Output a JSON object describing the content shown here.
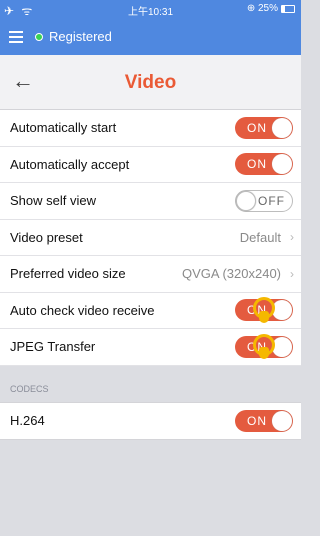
{
  "status_bar": {
    "left": "✈ ᯤ",
    "time": "上午10:31",
    "battery_percent": "⊕ 25%"
  },
  "top_bar": {
    "menu_icon": "hamburger-menu-icon",
    "status": "Registered",
    "status_color": "#39d353",
    "bg_color": "#4f88e0"
  },
  "nav": {
    "back_icon": "back-arrow-icon",
    "back_glyph": "←",
    "title": "Video",
    "title_color": "#ea5a35"
  },
  "settings": [
    {
      "label": "Automatically start",
      "toggle": "ON"
    },
    {
      "label": "Automatically accept",
      "toggle": "ON"
    },
    {
      "label": "Show self view",
      "toggle": "OFF"
    },
    {
      "label": "Video preset",
      "value": "Default",
      "chevron": "›"
    },
    {
      "label": "Preferred video size",
      "value": "QVGA (320x240)",
      "chevron": "›"
    },
    {
      "label": "Auto check video receive",
      "toggle": "ON"
    },
    {
      "label": "JPEG Transfer",
      "toggle": "ON"
    }
  ],
  "codecs_section": {
    "header": "CODECS",
    "items": [
      {
        "label": "H.264",
        "toggle": "ON"
      }
    ]
  }
}
